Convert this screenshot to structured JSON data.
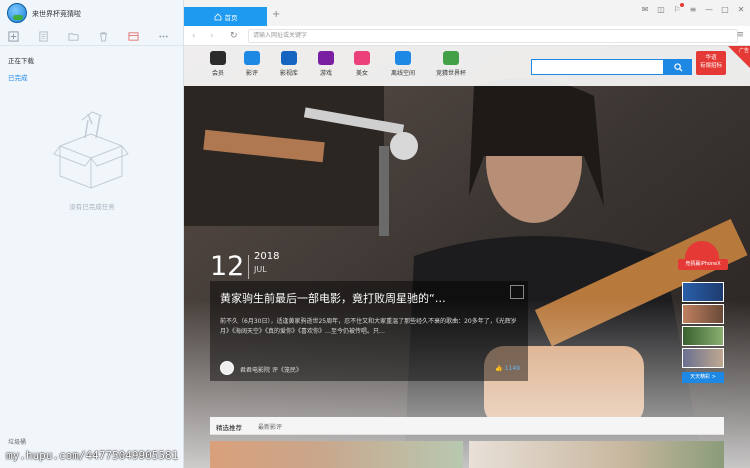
{
  "app": {
    "title": "来世界杯竞猜啦"
  },
  "left_panel": {
    "downloading": "正在下载",
    "completed": "已完成",
    "empty_text": "没有已完成任务",
    "recycle_bin": "垃圾桶",
    "toolbar_icons": [
      "new-task-icon",
      "open-file-icon",
      "folder-icon",
      "delete-icon",
      "card-icon",
      "more-icon"
    ]
  },
  "browser": {
    "tab_label": "首页",
    "address_placeholder": "请输入网址或关键字",
    "add_tab": "+"
  },
  "topnav": {
    "items": [
      {
        "label": "会员",
        "color": "#2b2b2b"
      },
      {
        "label": "影评",
        "color": "#1e88e5"
      },
      {
        "label": "影视库",
        "color": "#1565c0"
      },
      {
        "label": "游戏",
        "color": "#7b1fa2"
      },
      {
        "label": "美女",
        "color": "#ec407a"
      },
      {
        "label": "离线空间",
        "color": "#1e88e5"
      },
      {
        "label": "竞猜世界杯",
        "color": "#43a047"
      }
    ],
    "search_placeholder": "",
    "promo": [
      "华谊",
      "有偿招标"
    ],
    "corner_badge": "广告"
  },
  "hero": {
    "day": "12",
    "year": "2018",
    "month": "JUL",
    "title": "黄家驹生前最后一部电影，竟打败周星驰的“…",
    "summary": "前不久（6月30日），适逢黄家驹逝世25周年，忍不住又和大家重温了那些经久不衰的歌曲：20多年了，《光辉岁月》《海阔天空》《真的爱你》《喜欢你》…至今仍被传唱。只…",
    "author": "君君电影院",
    "comment_on": "评《笼民》",
    "likes": "1149"
  },
  "section": {
    "title": "精选推荐",
    "tab": "最新影评"
  },
  "side_ad": {
    "label": "竞猜赢iPhoneX",
    "more": "天天精彩 >"
  },
  "watermark": "my.hupu.com/44775049905581"
}
